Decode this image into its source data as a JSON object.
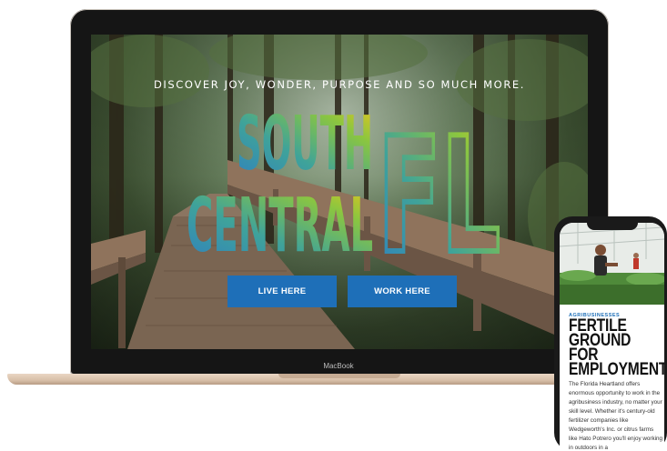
{
  "laptop": {
    "brand_label": "MacBook",
    "hero": {
      "tagline": "DISCOVER JOY, WONDER, PURPOSE AND SO MUCH MORE.",
      "logo_word_1": "SOUTH",
      "logo_word_2": "CENTRAL",
      "logo_monogram": "FL"
    },
    "buttons": {
      "live_label": "LIVE HERE",
      "work_label": "WORK HERE"
    }
  },
  "phone": {
    "category": "AGRIBUSINESSES",
    "headline": "FERTILE GROUND FOR EMPLOYMENT",
    "body": "The Florida Heartland offers enormous opportunity to work in the agribusiness industry, no matter your skill level. Whether it's century-old fertilizer companies like Wedgeworth's Inc. or citrus farms like Hato Potrero you'll enjoy working in outdoors in a"
  },
  "colors": {
    "accent_blue": "#1e6fb8",
    "logo_gradient": [
      "#2f7fc0",
      "#3fa39a",
      "#8cc63f",
      "#f0c419"
    ]
  }
}
